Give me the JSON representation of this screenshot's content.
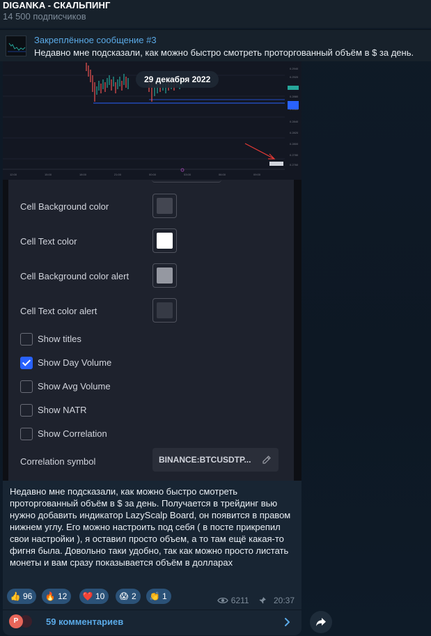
{
  "channel": {
    "title": "DIGANKA - СКАЛЬПИНГ",
    "subscribers": "14 500 подписчиков"
  },
  "pinned": {
    "title": "Закреплённое сообщение #3",
    "text": "Недавно мне подсказали, как можно быстро смотреть проторгованный объём в $ за день."
  },
  "media": {
    "date_badge": "29 декабря 2022"
  },
  "settings": {
    "color_rows": [
      {
        "label": "Cell Background color",
        "color": "#434651"
      },
      {
        "label": "Cell Text color",
        "color": "#ffffff"
      },
      {
        "label": "Cell Background color alert",
        "color": "#9598a1"
      },
      {
        "label": "Cell Text color alert",
        "color": "#363a45"
      }
    ],
    "checkboxes": [
      {
        "label": "Show titles",
        "checked": false
      },
      {
        "label": "Show Day Volume",
        "checked": true
      },
      {
        "label": "Show Avg Volume",
        "checked": false
      },
      {
        "label": "Show NATR",
        "checked": false
      },
      {
        "label": "Show Correlation",
        "checked": false
      }
    ],
    "correlation_label": "Correlation symbol",
    "correlation_value": "BINANCE:BTCUSDTP..."
  },
  "message": {
    "caption": "Недавно мне подсказали, как можно быстро смотреть проторгованный объём в $ за день. Получается в трейдинг вью нужно добавить индикатор LazyScalp Board, он появится в правом нижнем углу. Его можно настроить под себя ( в посте прикрепил свои настройки ), я оставил просто объем, а то там ещё какая-то фигня была. Довольно таки удобно, так как можно просто листать монеты и вам сразу показывается объём в долларах",
    "reactions": [
      {
        "emoji": "👍",
        "icon": "thumbs-up-icon",
        "count": "96"
      },
      {
        "emoji": "🔥",
        "icon": "fire-icon",
        "count": "12"
      },
      {
        "emoji": "❤️",
        "icon": "heart-icon",
        "count": "10"
      },
      {
        "emoji": "😱",
        "icon": "scream-face-icon",
        "count": "2"
      },
      {
        "emoji": "👏",
        "icon": "clapping-hands-icon",
        "count": "1"
      }
    ],
    "views": "6211",
    "time": "20:37",
    "comments_label": "59 комментариев",
    "avatar_letter": "P"
  },
  "colors": {
    "accent": "#5aa9e6",
    "bubble": "#182533",
    "reaction_bg": "#2b5278",
    "checkbox_checked": "#2962ff"
  }
}
